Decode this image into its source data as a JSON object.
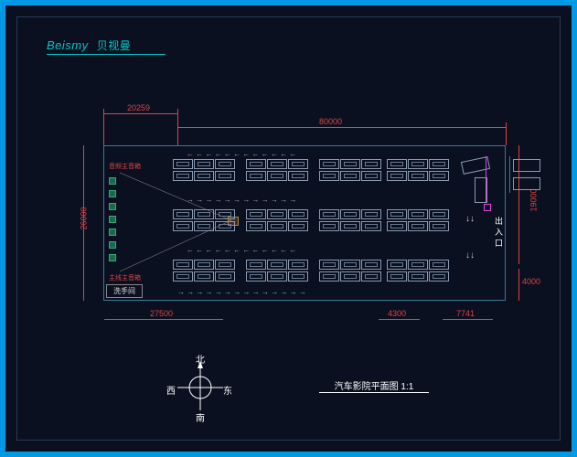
{
  "logo": {
    "brand": "Beismy",
    "brand_zh": "贝视曼"
  },
  "dimensions": {
    "top_left": "20259",
    "top_span": "80000",
    "left_height": "26000",
    "bottom_left": "27500",
    "bottom_mid": "4300",
    "bottom_right": "7741",
    "right_upper": "19000",
    "right_lower": "4000"
  },
  "rooms": {
    "washroom": "洗手间"
  },
  "poi": {
    "speaker1": "音频主音箱",
    "speaker2": "主线主音箱"
  },
  "entrance": "出入口",
  "compass": {
    "n": "北",
    "s": "南",
    "e": "东",
    "w": "西"
  },
  "title": "汽车影院平面图 1:1"
}
